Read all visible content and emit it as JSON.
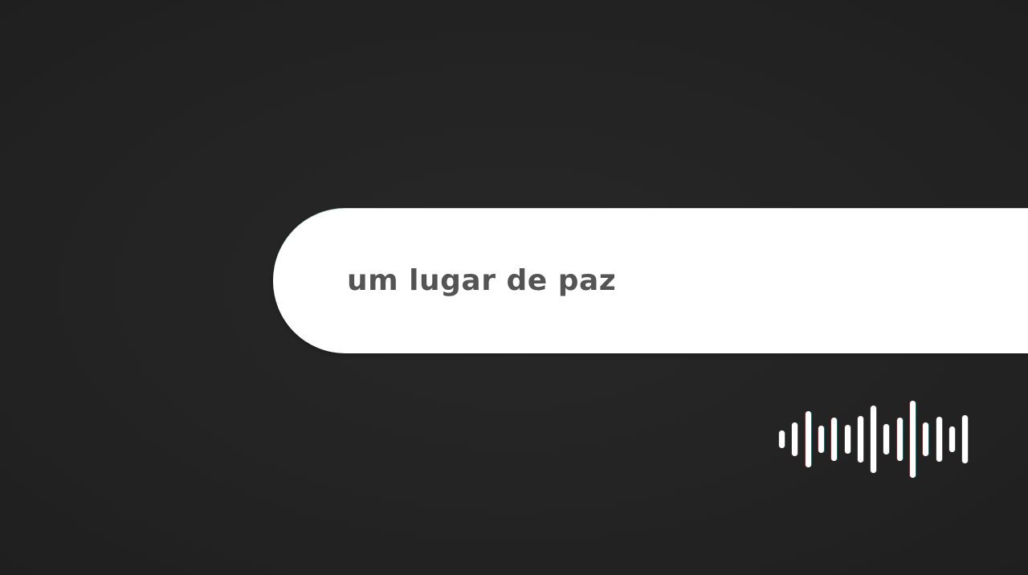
{
  "search": {
    "query_text": "um lugar de paz"
  },
  "voice_indicator": {
    "icon": "audio-waveform-icon",
    "bar_levels": [
      0.22,
      0.42,
      0.68,
      0.34,
      0.52,
      0.36,
      0.56,
      0.82,
      0.38,
      0.52,
      0.95,
      0.42,
      0.54,
      0.32,
      0.58
    ]
  },
  "colors": {
    "background": "#232323",
    "bar_fill": "#ffffff",
    "query_text": "#545454"
  }
}
